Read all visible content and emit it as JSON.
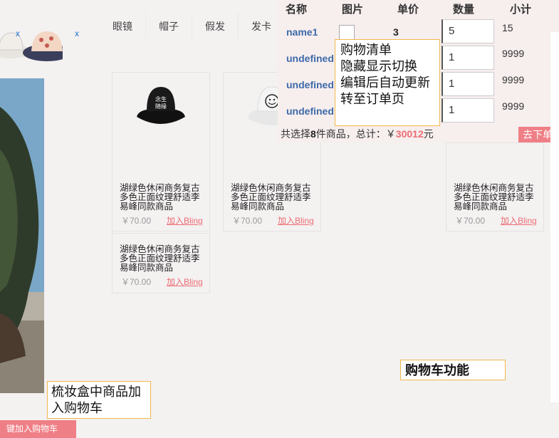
{
  "thumbnails": [
    {
      "name": "white-bucket-hat",
      "remove": "x"
    },
    {
      "name": "patterned-bucket-hat",
      "remove": "x"
    }
  ],
  "nav": [
    "眼镜",
    "帽子",
    "假发",
    "发卡"
  ],
  "products": [
    {
      "name": "湖绿色休闲商务复古多色正面纹理舒适李易峰同款商品",
      "price": "￥70.00",
      "add": "加入Bling",
      "image": "black-bucket-hat"
    },
    {
      "name": "湖绿色休闲商务复古多色正面纹理舒适李易峰同款商品",
      "price": "￥70.00",
      "add": "加入Bling",
      "image": "white-smiley-bucket-hat"
    },
    {
      "name": "湖绿色休闲商务复古多色正面纹理舒适李易峰同款商品",
      "price": "￥70.00",
      "add": "加入Bling",
      "image": ""
    },
    {
      "name": "湖绿色休闲商务复古多色正面纹理舒适李易峰同款商品",
      "price": "￥70.00",
      "add": "加入Bling",
      "image": ""
    }
  ],
  "cart": {
    "headers": {
      "name": "名称",
      "image": "图片",
      "price": "单价",
      "qty": "数量",
      "subtotal": "小计"
    },
    "rows": [
      {
        "name": "name1",
        "price": "3",
        "qty": "5",
        "subtotal": "15"
      },
      {
        "name": "undefined",
        "price": "",
        "qty": "1",
        "subtotal": "9999"
      },
      {
        "name": "undefined",
        "price": "",
        "qty": "1",
        "subtotal": "9999"
      },
      {
        "name": "undefined",
        "price": "",
        "qty": "1",
        "subtotal": "9999"
      }
    ],
    "summary_prefix": "共选择",
    "count": "8",
    "summary_mid": "件商品，总计：￥",
    "amount": "30012",
    "unit": "元",
    "checkout": "去下单"
  },
  "notes": {
    "cart_list": "购物清单\n隐藏显示切换\n编辑后自动更新\n转至订单页",
    "cart_feature": "购物车功能",
    "makeup_box": "梳妆盒中商品加\n入购物车"
  },
  "bottom_button": "键加入购物车",
  "colors": {
    "accent": "#ef7f86",
    "link": "#ec6d75",
    "cart_name": "#3d6aa9",
    "note_border": "#f0b84a"
  }
}
